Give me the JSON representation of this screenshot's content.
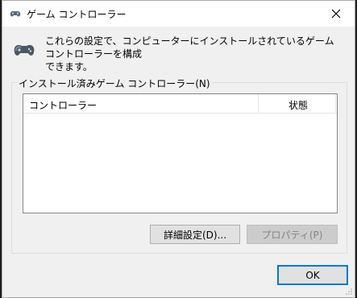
{
  "window": {
    "title": "ゲーム コントローラー",
    "close_icon": "close-icon"
  },
  "description": {
    "icon": "gamepad-icon",
    "text": "これらの設定で、コンピューターにインストールされているゲーム コントローラーを構成\nできます。"
  },
  "installed_group": {
    "label": "インストール済みゲーム コントローラー(N)",
    "columns": [
      "コントローラー",
      "状態"
    ],
    "rows": []
  },
  "buttons": {
    "advanced": "詳細設定(D)...",
    "properties": "プロパティ(P)",
    "ok": "OK"
  },
  "colors": {
    "accent": "#0078d7",
    "window_bg": "#f0f0f0",
    "disabled_text": "#838383"
  }
}
